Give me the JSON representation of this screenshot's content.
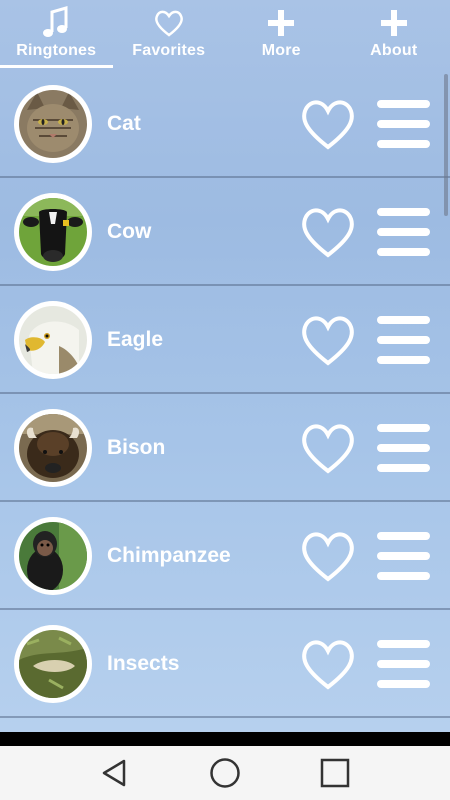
{
  "tabs": [
    {
      "label": "Ringtones",
      "icon": "music-note-icon",
      "active": true
    },
    {
      "label": "Favorites",
      "icon": "heart-outline-icon",
      "active": false
    },
    {
      "label": "More",
      "icon": "plus-icon",
      "active": false
    },
    {
      "label": "About",
      "icon": "plus-icon",
      "active": false
    }
  ],
  "ringtones": [
    {
      "name": "Cat",
      "photo": "cat-photo"
    },
    {
      "name": "Cow",
      "photo": "cow-photo"
    },
    {
      "name": "Eagle",
      "photo": "eagle-photo"
    },
    {
      "name": "Bison",
      "photo": "bison-photo"
    },
    {
      "name": "Chimpanzee",
      "photo": "chimpanzee-photo"
    },
    {
      "name": "Insects",
      "photo": "insects-photo"
    }
  ],
  "navbar": {
    "buttons": [
      "back-icon",
      "home-icon",
      "recents-icon"
    ]
  },
  "colors": {
    "background": "#a9c3e6",
    "text": "#ffffff",
    "divider": "#5a6e8c",
    "navbar": "#f5f5f5"
  }
}
